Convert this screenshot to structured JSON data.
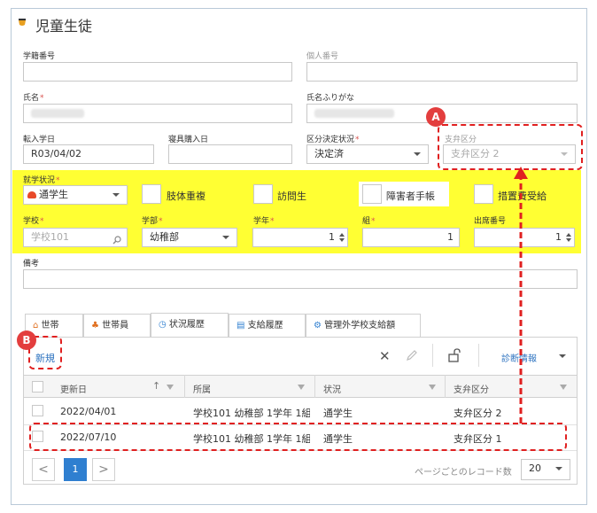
{
  "page_title": "児童生徒",
  "fields": {
    "student_no_label": "学籍番号",
    "personal_no_label": "個人番号",
    "name_label": "氏名",
    "name_kana_label": "氏名ふりがな",
    "enroll_date_label": "転入学日",
    "enroll_date_value": "R03/04/02",
    "bedding_date_label": "寝具購入日",
    "category_status_label": "区分決定状況",
    "category_status_value": "決定済",
    "support_category_label": "支弁区分",
    "support_category_value": "支弁区分 2",
    "attendance_label": "就学状況",
    "attendance_value": "通学生",
    "check_limb": "肢体重複",
    "check_visit": "訪問生",
    "check_handbook": "障害者手帳",
    "check_measure": "措置費受給",
    "school_label": "学校",
    "school_placeholder": "学校101",
    "dept_label": "学部",
    "dept_value": "幼稚部",
    "grade_label": "学年",
    "grade_value": "1",
    "class_label": "組",
    "class_value": "1",
    "seat_label": "出席番号",
    "seat_value": "1",
    "note_label": "備考"
  },
  "tabs": [
    {
      "label": "世帯",
      "icon": "house-icon"
    },
    {
      "label": "世帯員",
      "icon": "people-icon"
    },
    {
      "label": "状況履歴",
      "icon": "clock-icon"
    },
    {
      "label": "支給履歴",
      "icon": "document-icon"
    },
    {
      "label": "管理外学校支給額",
      "icon": "school-icon"
    }
  ],
  "toolbar": {
    "new_label": "新規",
    "diagnostics_label": "診断情報"
  },
  "grid": {
    "columns": [
      "更新日",
      "所属",
      "状況",
      "支弁区分"
    ],
    "rows": [
      {
        "date": "2022/04/01",
        "affiliation": "学校101 幼稚部 1学年 1組 ...",
        "status": "通学生",
        "support": "支弁区分 2"
      },
      {
        "date": "2022/07/10",
        "affiliation": "学校101 幼稚部 1学年 1組 ...",
        "status": "通学生",
        "support": "支弁区分 1"
      }
    ]
  },
  "pager": {
    "prev": "<",
    "page": "1",
    "next": ">",
    "per_page_label": "ページごとのレコード数",
    "per_page_value": "20"
  },
  "annotations": {
    "a": "A",
    "b": "B"
  },
  "colors": {
    "highlight": "#ffff33",
    "accent": "#2f7fd0",
    "annotation": "#e02020"
  }
}
